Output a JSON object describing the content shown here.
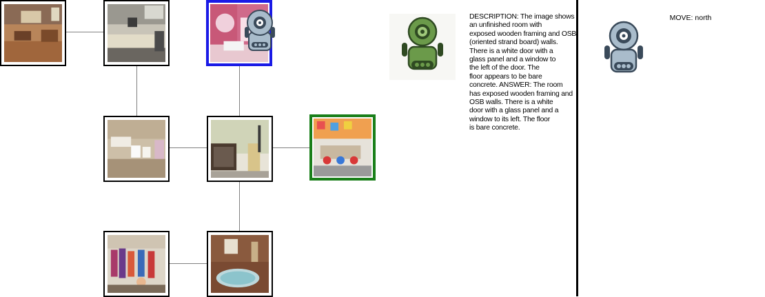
{
  "panels": {
    "description": "DESCRIPTION: The image shows\nan unfinished room with\nexposed wooden framing and OSB\n(oriented strand board) walls.\nThere is a white door with a\nglass panel and a window to\nthe left of the door. The\nfloor appears to be bare\nconcrete.  ANSWER: The room\nhas exposed wooden framing and\nOSB walls. There is a white\ndoor with a glass panel and a\nwindow to its left. The floor\nis bare concrete.",
    "move": "MOVE: north"
  },
  "colors": {
    "current_border": "#1a1ae6",
    "target_border": "#1a7f1a",
    "edge": "#808080",
    "agent_robot": "#a9bccb",
    "avatar_robot": "#6b9a4a"
  }
}
